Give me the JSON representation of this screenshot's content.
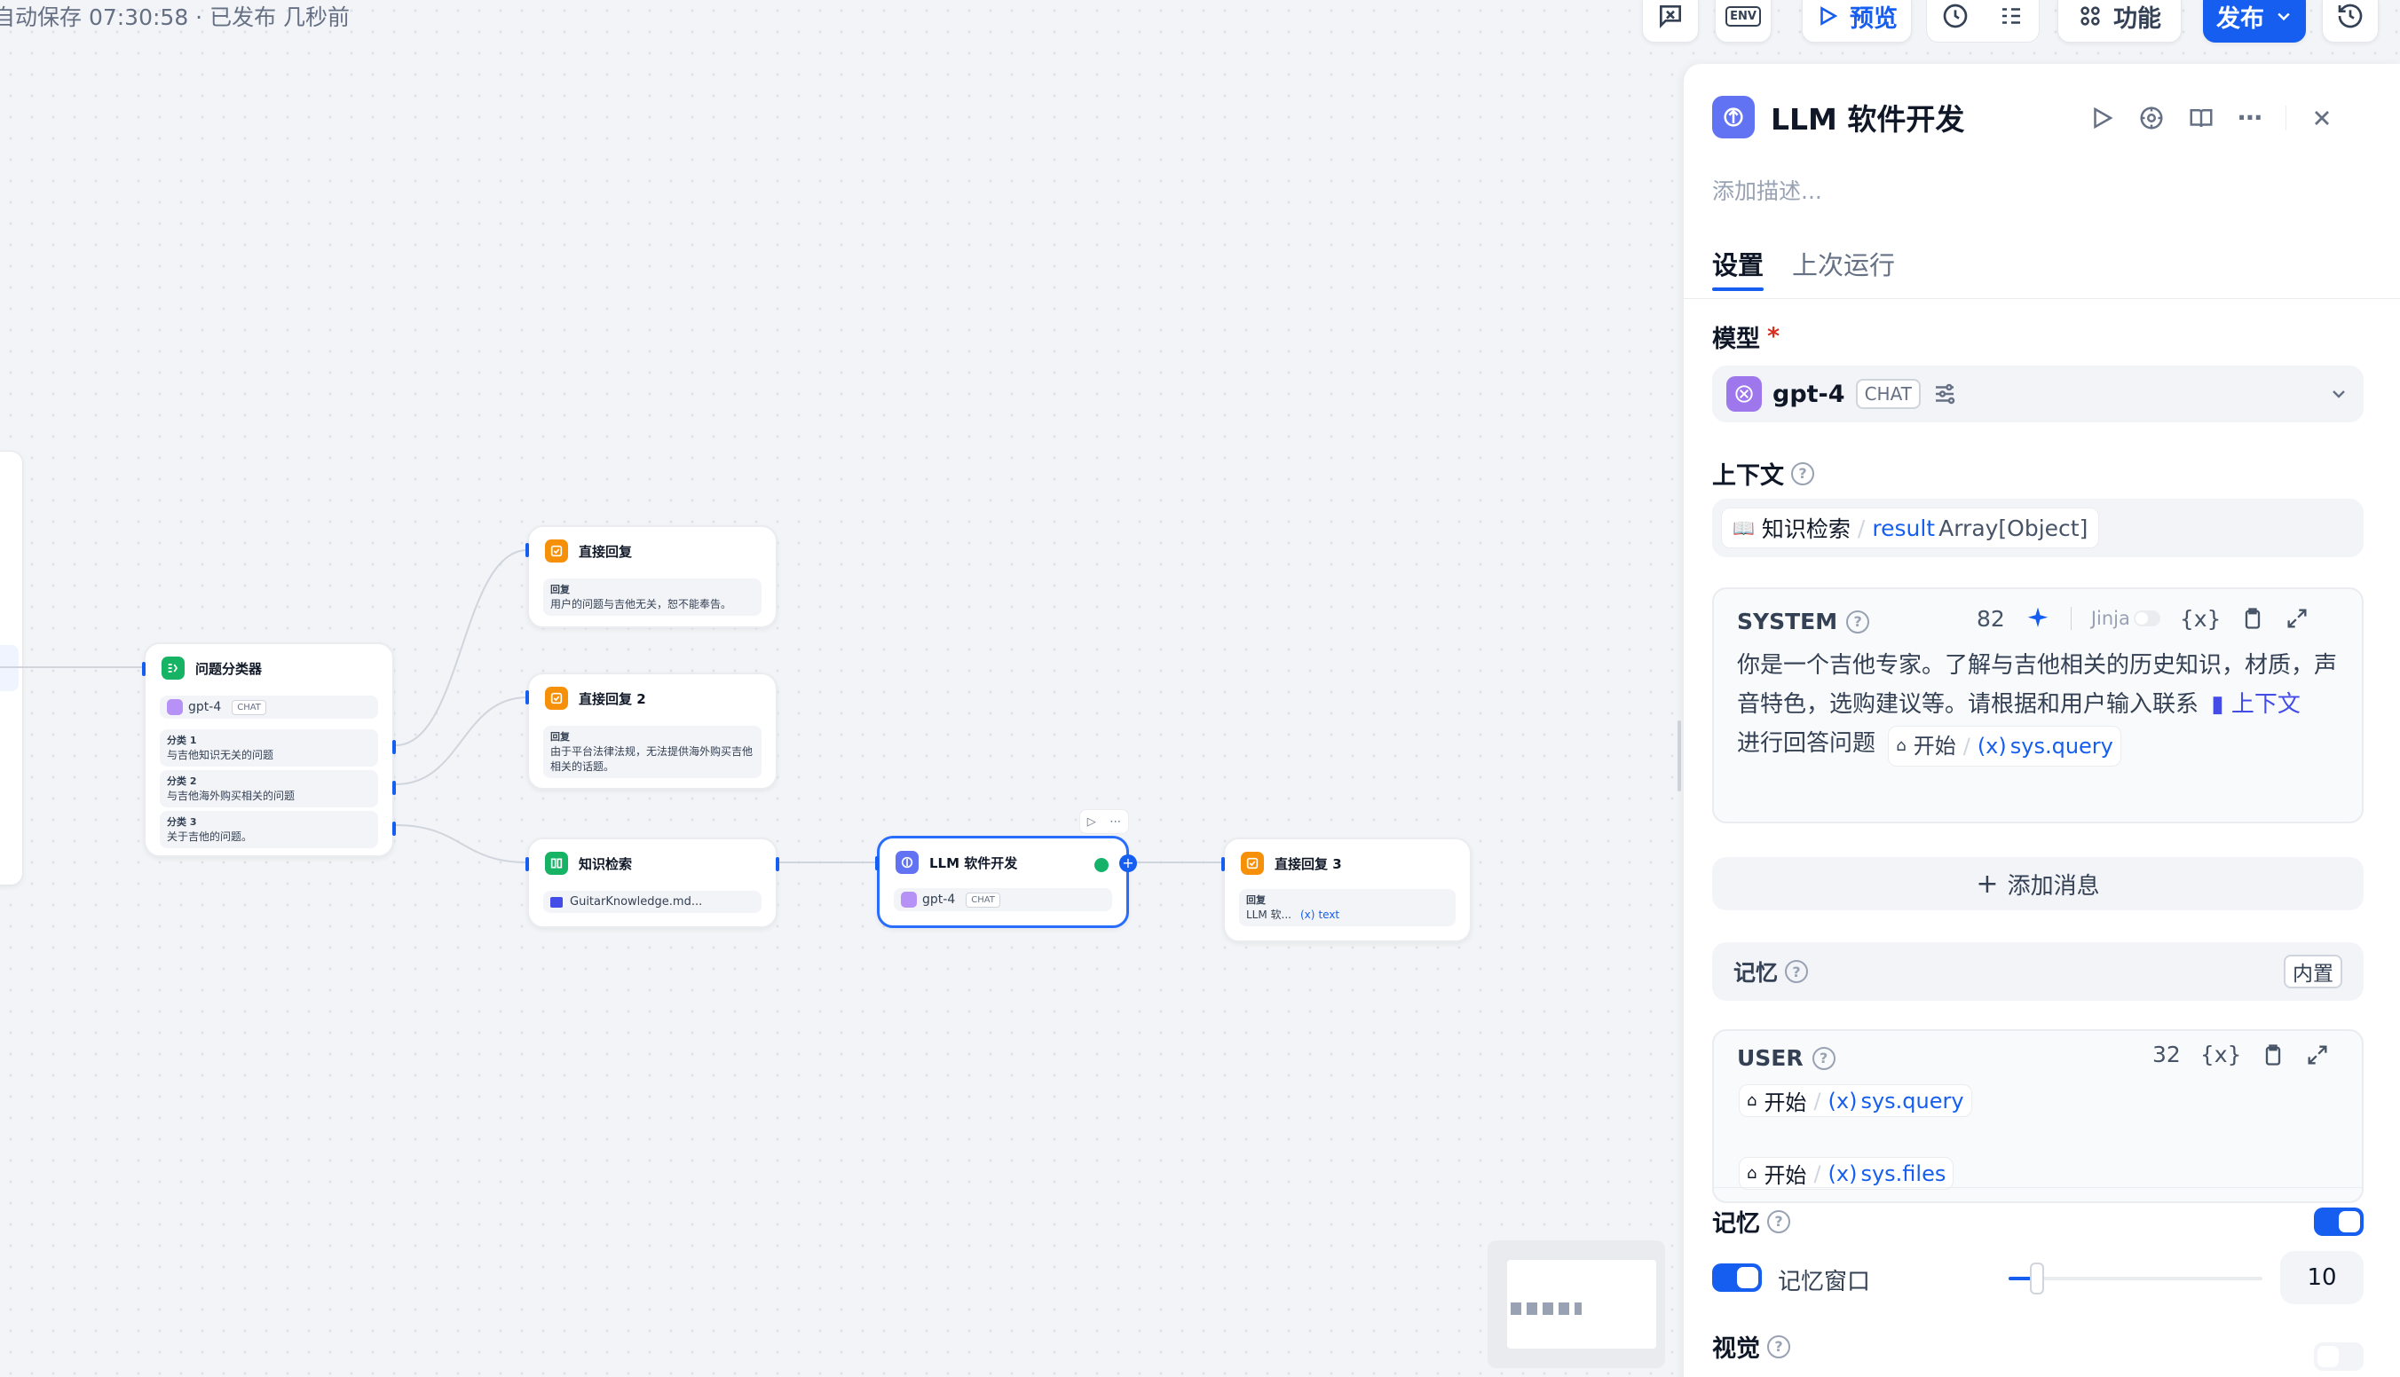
{
  "status_text": "自动保存 07:30:58 · 已发布 几秒前",
  "toolbar": {
    "preview": "预览",
    "features": "功能",
    "publish": "发布",
    "env_icon_text": "ENV"
  },
  "nodes": {
    "classifier": {
      "title": "问题分类器",
      "model": "gpt-4",
      "model_mode": "CHAT",
      "classes": [
        {
          "label": "分类 1",
          "text": "与吉他知识无关的问题"
        },
        {
          "label": "分类 2",
          "text": "与吉他海外购买相关的问题"
        },
        {
          "label": "分类 3",
          "text": "关于吉他的问题。"
        }
      ]
    },
    "answer1": {
      "title": "直接回复",
      "label": "回复",
      "text": "用户的问题与吉他无关，恕不能奉告。"
    },
    "answer2": {
      "title": "直接回复 2",
      "label": "回复",
      "text": "由于平台法律法规，无法提供海外购买吉他相关的话题。"
    },
    "retrieval": {
      "title": "知识检索",
      "dataset": "GuitarKnowledge.md..."
    },
    "llm": {
      "title": "LLM 软件开发",
      "model": "gpt-4",
      "model_mode": "CHAT"
    },
    "answer3": {
      "title": "直接回复 3",
      "label": "回复",
      "ref_node": "LLM 软...",
      "ref_var": "text"
    }
  },
  "panel": {
    "title": "LLM 软件开发",
    "desc_placeholder": "添加描述...",
    "tabs": [
      "设置",
      "上次运行"
    ],
    "model_label": "模型",
    "model_name": "gpt-4",
    "model_mode": "CHAT",
    "context_label": "上下文",
    "context_var": {
      "node": "知识检索",
      "name": "result",
      "type": "Array[Object]"
    },
    "system": {
      "role": "SYSTEM",
      "count": "82",
      "jinja": "Jinja",
      "text1": "你是一个吉他专家。了解与吉他相关的历史知识，材质，声音特色，选购建议等。请根据和用户输入联系",
      "context_tag": "上下文",
      "text2": "进行回答问题",
      "var_node": "开始",
      "var_name": "sys.query"
    },
    "add_message": "添加消息",
    "memory_label": "记忆",
    "memory_badge": "内置",
    "user": {
      "role": "USER",
      "count": "32",
      "var1": {
        "node": "开始",
        "name": "sys.query"
      },
      "var2": {
        "node": "开始",
        "name": "sys.files"
      }
    },
    "memory2_label": "记忆",
    "memory_window_label": "记忆窗口",
    "memory_window_value": "10",
    "vision_label": "视觉"
  },
  "colors": {
    "accent": "#155eef",
    "llm": "#6172f3",
    "answer": "#f79009",
    "knowledge": "#16b364",
    "classifier": "#16b364"
  }
}
